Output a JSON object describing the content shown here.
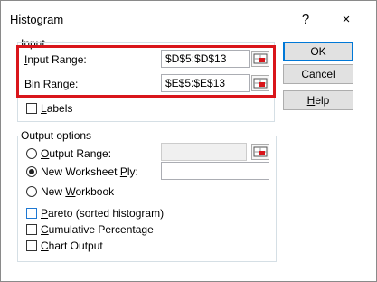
{
  "window": {
    "title": "Histogram",
    "help_glyph": "?",
    "close_glyph": "×"
  },
  "input_group": {
    "label": "Input",
    "input_range": {
      "label_mn": "I",
      "label_rest": "nput Range:",
      "value": "$D$5:$D$13"
    },
    "bin_range": {
      "label_mn": "B",
      "label_rest": "in Range:",
      "value": "$E$5:$E$13"
    },
    "labels_checkbox": {
      "label_mn": "L",
      "label_rest": "abels",
      "checked": false
    }
  },
  "output_group": {
    "label": "Output options",
    "output_range": {
      "label_mn": "O",
      "label_rest": "utput Range:",
      "value": "",
      "selected": false
    },
    "new_worksheet": {
      "label_pre": "New Worksheet ",
      "label_mn": "P",
      "label_rest": "ly:",
      "value": "",
      "selected": true
    },
    "new_workbook": {
      "label_pre": "New ",
      "label_mn": "W",
      "label_rest": "orkbook",
      "selected": false
    },
    "pareto": {
      "label_mn": "P",
      "label_rest": "areto (sorted histogram)",
      "checked": false
    },
    "cumulative": {
      "label_mn": "C",
      "label_rest": "umulative Percentage",
      "checked": false
    },
    "chart_output": {
      "label_mn": "C",
      "label_rest": "hart Output",
      "checked": false
    }
  },
  "buttons": {
    "ok": "OK",
    "cancel": "Cancel",
    "help_mn": "H",
    "help_rest": "elp"
  },
  "colors": {
    "highlight_box": "#d9151b",
    "focus_blue": "#0078d7"
  }
}
